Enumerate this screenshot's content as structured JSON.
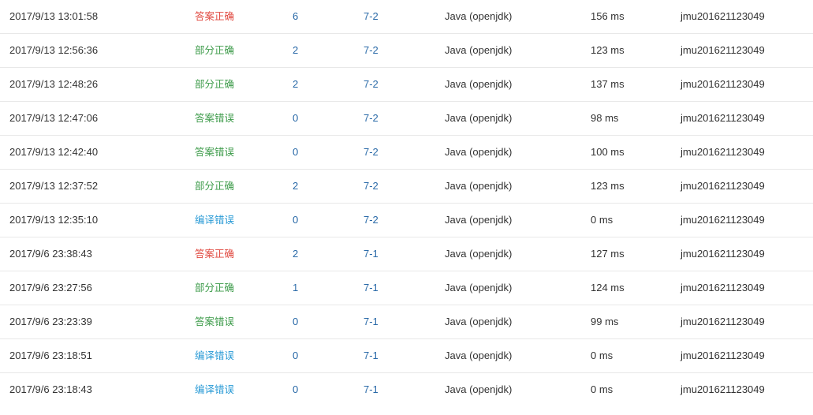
{
  "submissions": [
    {
      "time": "2017/9/13 13:01:58",
      "status": "答案正确",
      "status_type": "accepted",
      "score": "6",
      "problem": "7-2",
      "compiler": "Java (openjdk)",
      "runtime": "156 ms",
      "user": "jmu201621123049"
    },
    {
      "time": "2017/9/13 12:56:36",
      "status": "部分正确",
      "status_type": "partial",
      "score": "2",
      "problem": "7-2",
      "compiler": "Java (openjdk)",
      "runtime": "123 ms",
      "user": "jmu201621123049"
    },
    {
      "time": "2017/9/13 12:48:26",
      "status": "部分正确",
      "status_type": "partial",
      "score": "2",
      "problem": "7-2",
      "compiler": "Java (openjdk)",
      "runtime": "137 ms",
      "user": "jmu201621123049"
    },
    {
      "time": "2017/9/13 12:47:06",
      "status": "答案错误",
      "status_type": "wrong",
      "score": "0",
      "problem": "7-2",
      "compiler": "Java (openjdk)",
      "runtime": "98 ms",
      "user": "jmu201621123049"
    },
    {
      "time": "2017/9/13 12:42:40",
      "status": "答案错误",
      "status_type": "wrong",
      "score": "0",
      "problem": "7-2",
      "compiler": "Java (openjdk)",
      "runtime": "100 ms",
      "user": "jmu201621123049"
    },
    {
      "time": "2017/9/13 12:37:52",
      "status": "部分正确",
      "status_type": "partial",
      "score": "2",
      "problem": "7-2",
      "compiler": "Java (openjdk)",
      "runtime": "123 ms",
      "user": "jmu201621123049"
    },
    {
      "time": "2017/9/13 12:35:10",
      "status": "编译错误",
      "status_type": "compile",
      "score": "0",
      "problem": "7-2",
      "compiler": "Java (openjdk)",
      "runtime": "0 ms",
      "user": "jmu201621123049"
    },
    {
      "time": "2017/9/6 23:38:43",
      "status": "答案正确",
      "status_type": "accepted",
      "score": "2",
      "problem": "7-1",
      "compiler": "Java (openjdk)",
      "runtime": "127 ms",
      "user": "jmu201621123049"
    },
    {
      "time": "2017/9/6 23:27:56",
      "status": "部分正确",
      "status_type": "partial",
      "score": "1",
      "problem": "7-1",
      "compiler": "Java (openjdk)",
      "runtime": "124 ms",
      "user": "jmu201621123049"
    },
    {
      "time": "2017/9/6 23:23:39",
      "status": "答案错误",
      "status_type": "wrong",
      "score": "0",
      "problem": "7-1",
      "compiler": "Java (openjdk)",
      "runtime": "99 ms",
      "user": "jmu201621123049"
    },
    {
      "time": "2017/9/6 23:18:51",
      "status": "编译错误",
      "status_type": "compile",
      "score": "0",
      "problem": "7-1",
      "compiler": "Java (openjdk)",
      "runtime": "0 ms",
      "user": "jmu201621123049"
    },
    {
      "time": "2017/9/6 23:18:43",
      "status": "编译错误",
      "status_type": "compile",
      "score": "0",
      "problem": "7-1",
      "compiler": "Java (openjdk)",
      "runtime": "0 ms",
      "user": "jmu201621123049"
    }
  ],
  "colors": {
    "accepted": "#e0473e",
    "partial": "#3d9b4a",
    "wrong": "#3d9b4a",
    "compile": "#2a9bd6",
    "link": "#2a6aa8",
    "text": "#333333",
    "divider": "#e8e8e8"
  }
}
